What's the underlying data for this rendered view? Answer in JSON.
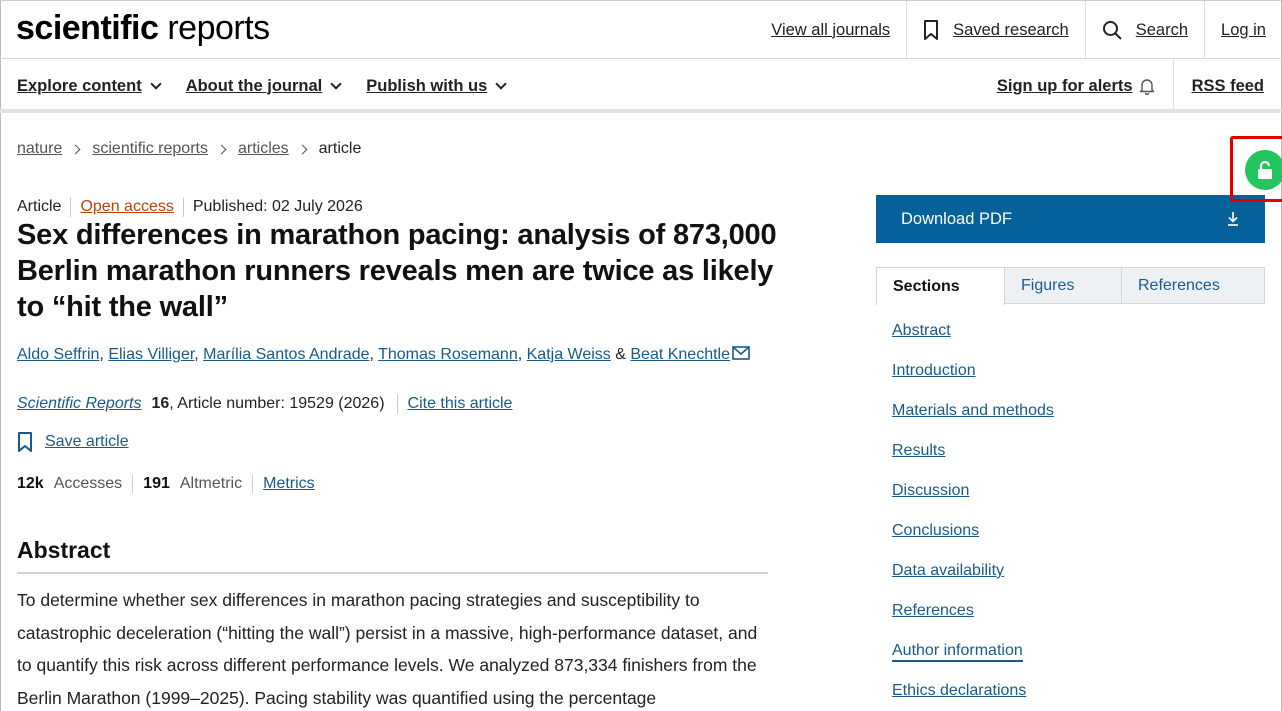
{
  "header": {
    "logo_bold": "scientific",
    "logo_light": "reports",
    "links": {
      "view_all_journals": "View all journals",
      "saved_research": "Saved research",
      "search": "Search",
      "log_in": "Log in"
    }
  },
  "nav": {
    "items": [
      "Explore content",
      "About the journal",
      "Publish with us"
    ],
    "alerts": "Sign up for alerts",
    "rss": "RSS feed"
  },
  "breadcrumb": [
    "nature",
    "scientific reports",
    "articles",
    "article"
  ],
  "article": {
    "type": "Article",
    "access": "Open access",
    "published": "Published: 02 July 2026",
    "title": "Sex differences in marathon pacing: analysis of 873,000 Berlin marathon runners reveals men are twice as likely to “hit the wall”",
    "authors": [
      "Aldo Seffrin",
      "Elias Villiger",
      "Marília Santos Andrade",
      "Thomas Rosemann",
      "Katja Weiss",
      "Beat Knechtle"
    ],
    "author_sep": ", ",
    "author_last_sep": " & ",
    "journal_name": "Scientific Reports",
    "volume": "16",
    "article_number": ", Article number: 19529 (2026)",
    "cite": "Cite this article",
    "save": "Save article",
    "accesses_value": "12k",
    "accesses_label": "Accesses",
    "altmetric_value": "191",
    "altmetric_label": "Altmetric",
    "metrics": "Metrics"
  },
  "abstract": {
    "heading": "Abstract",
    "text": "To determine whether sex differences in marathon pacing strategies and susceptibility to catastrophic deceleration (“hitting the wall”) persist in a massive, high-performance dataset, and to quantify this risk across different performance levels. We analyzed 873,334 finishers from the Berlin Marathon (1999–2025). Pacing stability was quantified using the percentage"
  },
  "sidebar": {
    "download": "Download PDF",
    "tabs": [
      "Sections",
      "Figures",
      "References"
    ],
    "sections": [
      "Abstract",
      "Introduction",
      "Materials and methods",
      "Results",
      "Discussion",
      "Conclusions",
      "Data availability",
      "References",
      "Author information",
      "Ethics declarations"
    ],
    "current_section": "Author information"
  },
  "colors": {
    "brand_blue": "#056199",
    "link_blue": "#1a5a8a",
    "open_access": "#b8430c",
    "lock_badge": "#22c55e",
    "highlight": "#e00000"
  }
}
